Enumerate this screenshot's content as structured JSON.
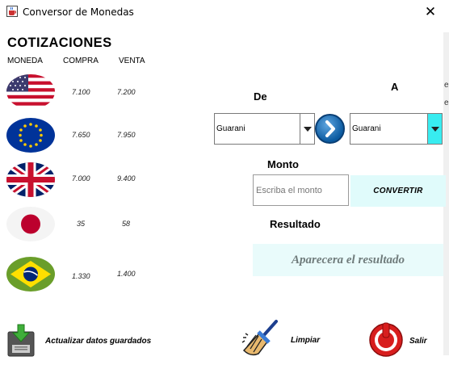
{
  "window": {
    "title": "Conversor de Monedas",
    "close_glyph": "✕",
    "app_icon": "java-coffee-icon"
  },
  "cotizaciones": {
    "title": "COTIZACIONES",
    "headers": {
      "moneda": "MONEDA",
      "compra": "COMPRA",
      "venta": "VENTA"
    },
    "rows": [
      {
        "flag": "usa-flag-icon",
        "compra": "7.100",
        "venta": "7.200"
      },
      {
        "flag": "eu-flag-icon",
        "compra": "7.650",
        "venta": "7.950"
      },
      {
        "flag": "uk-flag-icon",
        "compra": "7.000",
        "venta": "9.400"
      },
      {
        "flag": "japan-flag-icon",
        "compra": "35",
        "venta": "58"
      },
      {
        "flag": "brazil-flag-icon",
        "compra": "1.330",
        "venta": "1.400"
      }
    ]
  },
  "converter": {
    "de_label": "De",
    "a_label": "A",
    "de_value": "Guarani",
    "a_value": "Guarani",
    "monto_label": "Monto",
    "monto_placeholder": "Escriba el monto",
    "convert_label": "CONVERTIR",
    "resultado_label": "Resultado",
    "resultado_placeholder": "Aparecera el resultado",
    "swap_icon": "chevron-right-circle-icon"
  },
  "actions": {
    "update_label": "Actualizar datos guardados",
    "clear_label": "Limpiar",
    "exit_label": "Salir"
  },
  "colors": {
    "combo_arrow_highlight": "#38ecf0",
    "convert_bg": "#e0fbfb",
    "result_bg": "#e9fbfb",
    "swap_blue": "#0b5aa0",
    "exit_red": "#d81e1e"
  }
}
